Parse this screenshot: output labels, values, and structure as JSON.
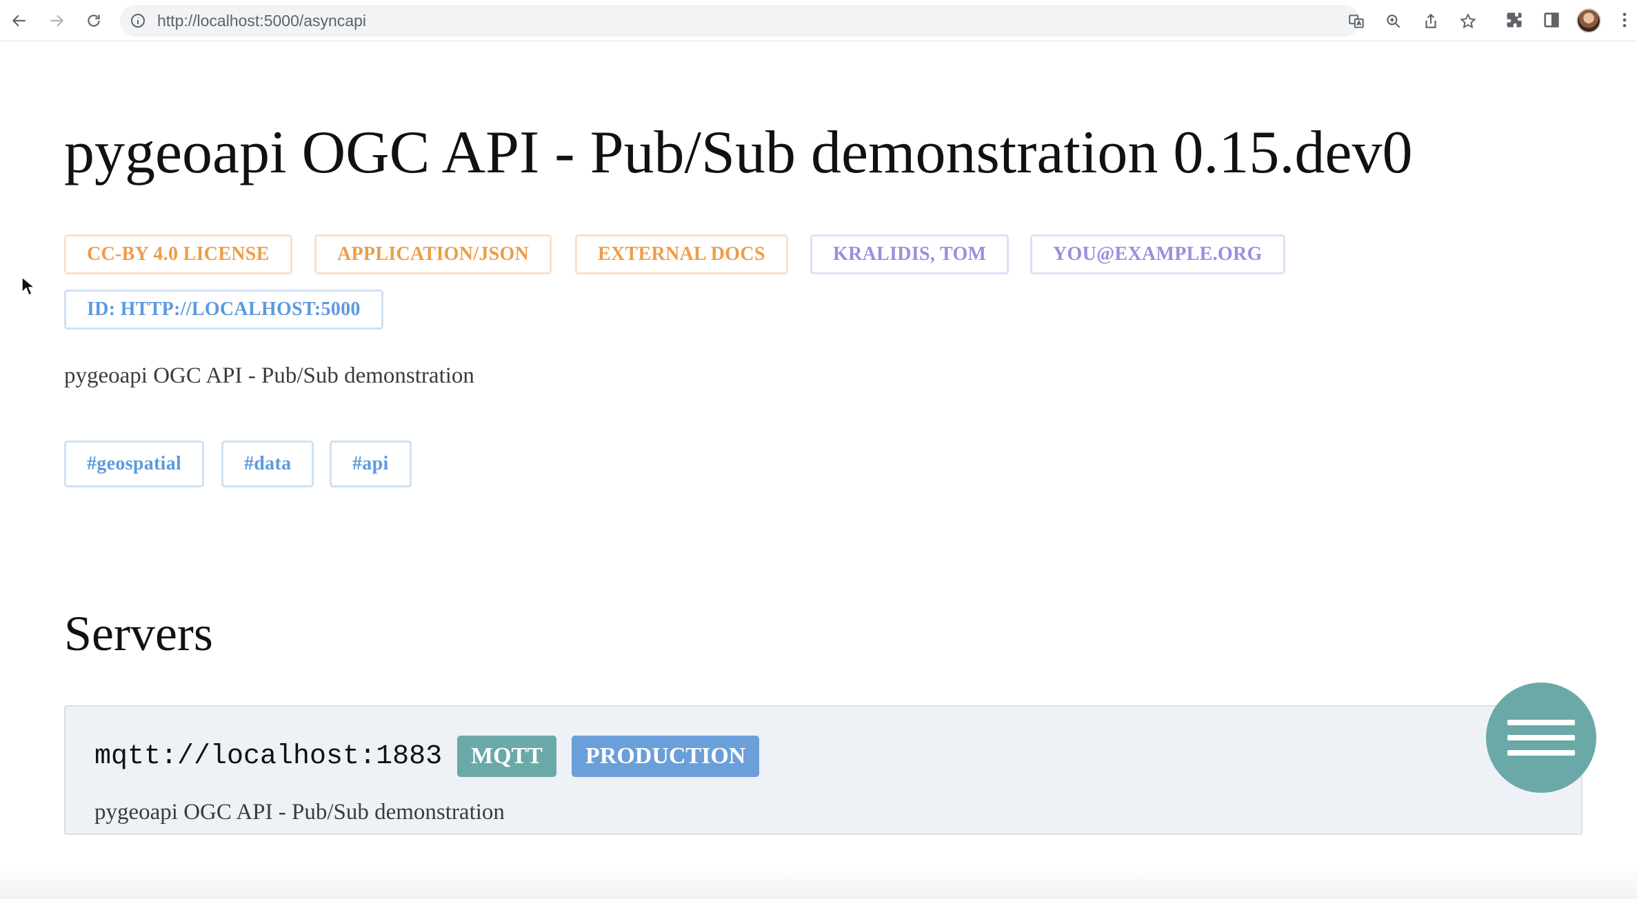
{
  "browser": {
    "url": "http://localhost:5000/asyncapi",
    "icons": [
      "back-arrow-icon",
      "forward-arrow-icon",
      "reload-icon",
      "info-icon",
      "translate-icon",
      "zoom-icon",
      "share-icon",
      "star-icon",
      "extensions-icon",
      "side-panel-icon",
      "avatar",
      "more-vert-icon"
    ]
  },
  "page": {
    "title": "pygeoapi OGC API - Pub/Sub demonstration 0.15.dev0",
    "info_tags": [
      {
        "label": "CC-BY 4.0 LICENSE",
        "color": "#ee9d48"
      },
      {
        "label": "APPLICATION/JSON",
        "color": "#ee9d48"
      },
      {
        "label": "EXTERNAL DOCS",
        "color": "#ee9d48"
      },
      {
        "label": "KRALIDIS, TOM",
        "color": "#9a8ee0"
      },
      {
        "label": "YOU@EXAMPLE.ORG",
        "color": "#9a8ee0"
      },
      {
        "label": "ID: HTTP://LOCALHOST:5000",
        "color": "#5b9ae0"
      }
    ],
    "description": "pygeoapi OGC API - Pub/Sub demonstration",
    "keyword_tags": [
      "#geospatial",
      "#data",
      "#api"
    ],
    "servers_heading": "Servers",
    "server": {
      "url": "mqtt://localhost:1883",
      "protocol_badge": "MQTT",
      "environment_badge": "PRODUCTION",
      "description": "pygeoapi OGC API - Pub/Sub demonstration"
    },
    "menu_button": "menu-icon"
  },
  "colors": {
    "accent_teal": "#6aa9a8",
    "accent_blue": "#6a9fd9",
    "tag_orange": "#ee9d48",
    "tag_purple": "#9a8ee0",
    "tag_blue": "#5b9ae0"
  }
}
